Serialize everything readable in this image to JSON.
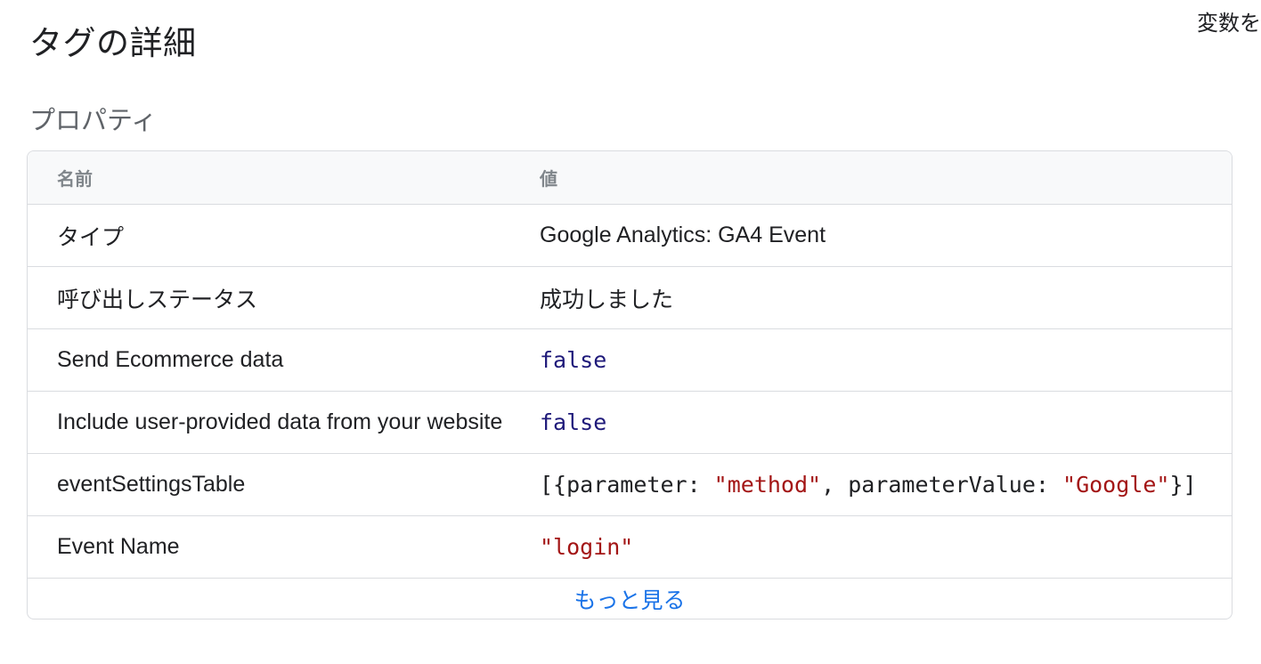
{
  "header": {
    "title": "タグの詳細",
    "top_right_link": "変数を"
  },
  "properties": {
    "section_title": "プロパティ",
    "columns": {
      "name": "名前",
      "value": "値"
    },
    "rows": [
      {
        "name": "タイプ",
        "value": "Google Analytics: GA4 Event"
      },
      {
        "name": "呼び出しステータス",
        "value": "成功しました"
      },
      {
        "name": "Send Ecommerce data",
        "value": "false"
      },
      {
        "name": "Include user-provided data from your website",
        "value": "false"
      },
      {
        "name": "eventSettingsTable",
        "value_parts": {
          "open": "[{parameter: ",
          "param": "\"method\"",
          "mid": ", parameterValue: ",
          "param_value": "\"Google\"",
          "close": "}]"
        }
      },
      {
        "name": "Event Name",
        "value": "\"login\""
      }
    ],
    "more_label": "もっと見る"
  },
  "colors": {
    "keyword": "#1f1a7a",
    "string": "#a31515",
    "link": "#1a73e8",
    "border": "#dadce0",
    "header_bg": "#f8f9fa"
  }
}
